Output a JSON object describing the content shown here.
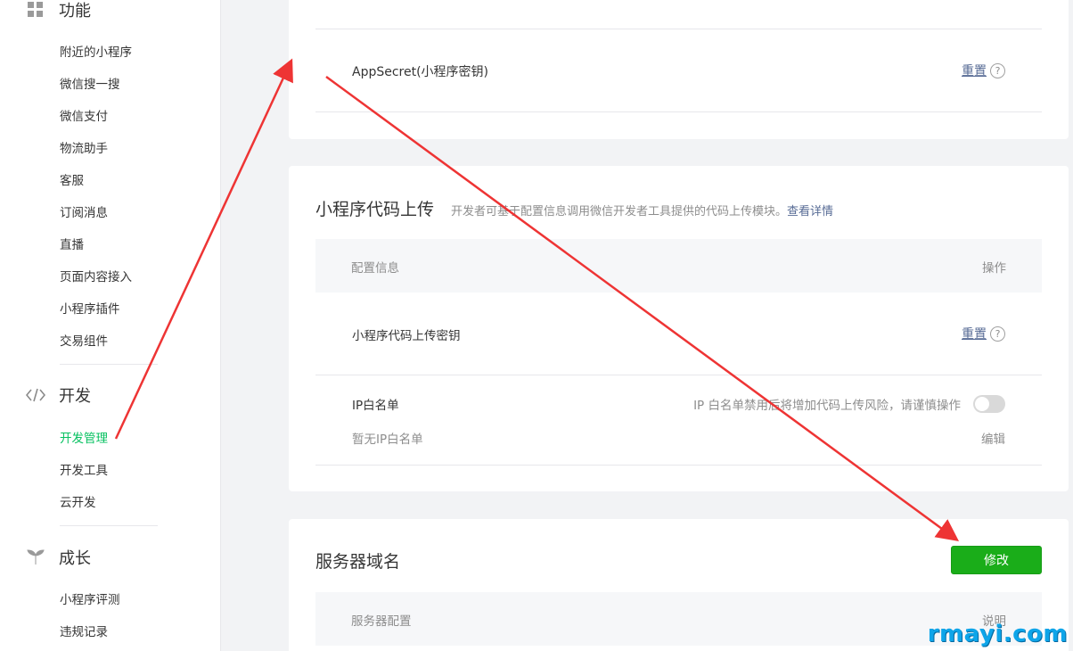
{
  "sidebar": {
    "sections": [
      {
        "title": "功能",
        "icon": "grid-icon"
      },
      {
        "title": "开发",
        "icon": "code-icon"
      },
      {
        "title": "成长",
        "icon": "sprout-icon"
      }
    ],
    "function_items": [
      "附近的小程序",
      "微信搜一搜",
      "微信支付",
      "物流助手",
      "客服",
      "订阅消息",
      "直播",
      "页面内容接入",
      "小程序插件",
      "交易组件"
    ],
    "dev_items": [
      "开发管理",
      "开发工具",
      "云开发"
    ],
    "growth_items": [
      "小程序评测",
      "违规记录"
    ]
  },
  "appsecret": {
    "label": "AppSecret(小程序密钥)",
    "reset": "重置",
    "help": "?"
  },
  "upload": {
    "title": "小程序代码上传",
    "desc": "开发者可基于配置信息调用微信开发者工具提供的代码上传模块。",
    "desc_link": "查看详情",
    "col_config": "配置信息",
    "col_action": "操作",
    "key_label": "小程序代码上传密钥",
    "key_reset": "重置",
    "help": "?",
    "ip_label": "IP白名单",
    "ip_warning": "IP 白名单禁用后将增加代码上传风险，请谨慎操作",
    "ip_toggle_on": false,
    "ip_empty": "暂无IP白名单",
    "ip_edit": "编辑"
  },
  "server": {
    "title": "服务器域名",
    "modify": "修改",
    "col_config": "服务器配置",
    "col_desc": "说明"
  },
  "watermark": "rmayi.com",
  "colors": {
    "accent_green": "#07c160",
    "button_green": "#1aad19",
    "link_blue": "#576b95",
    "annotation_red": "#ee3434"
  }
}
